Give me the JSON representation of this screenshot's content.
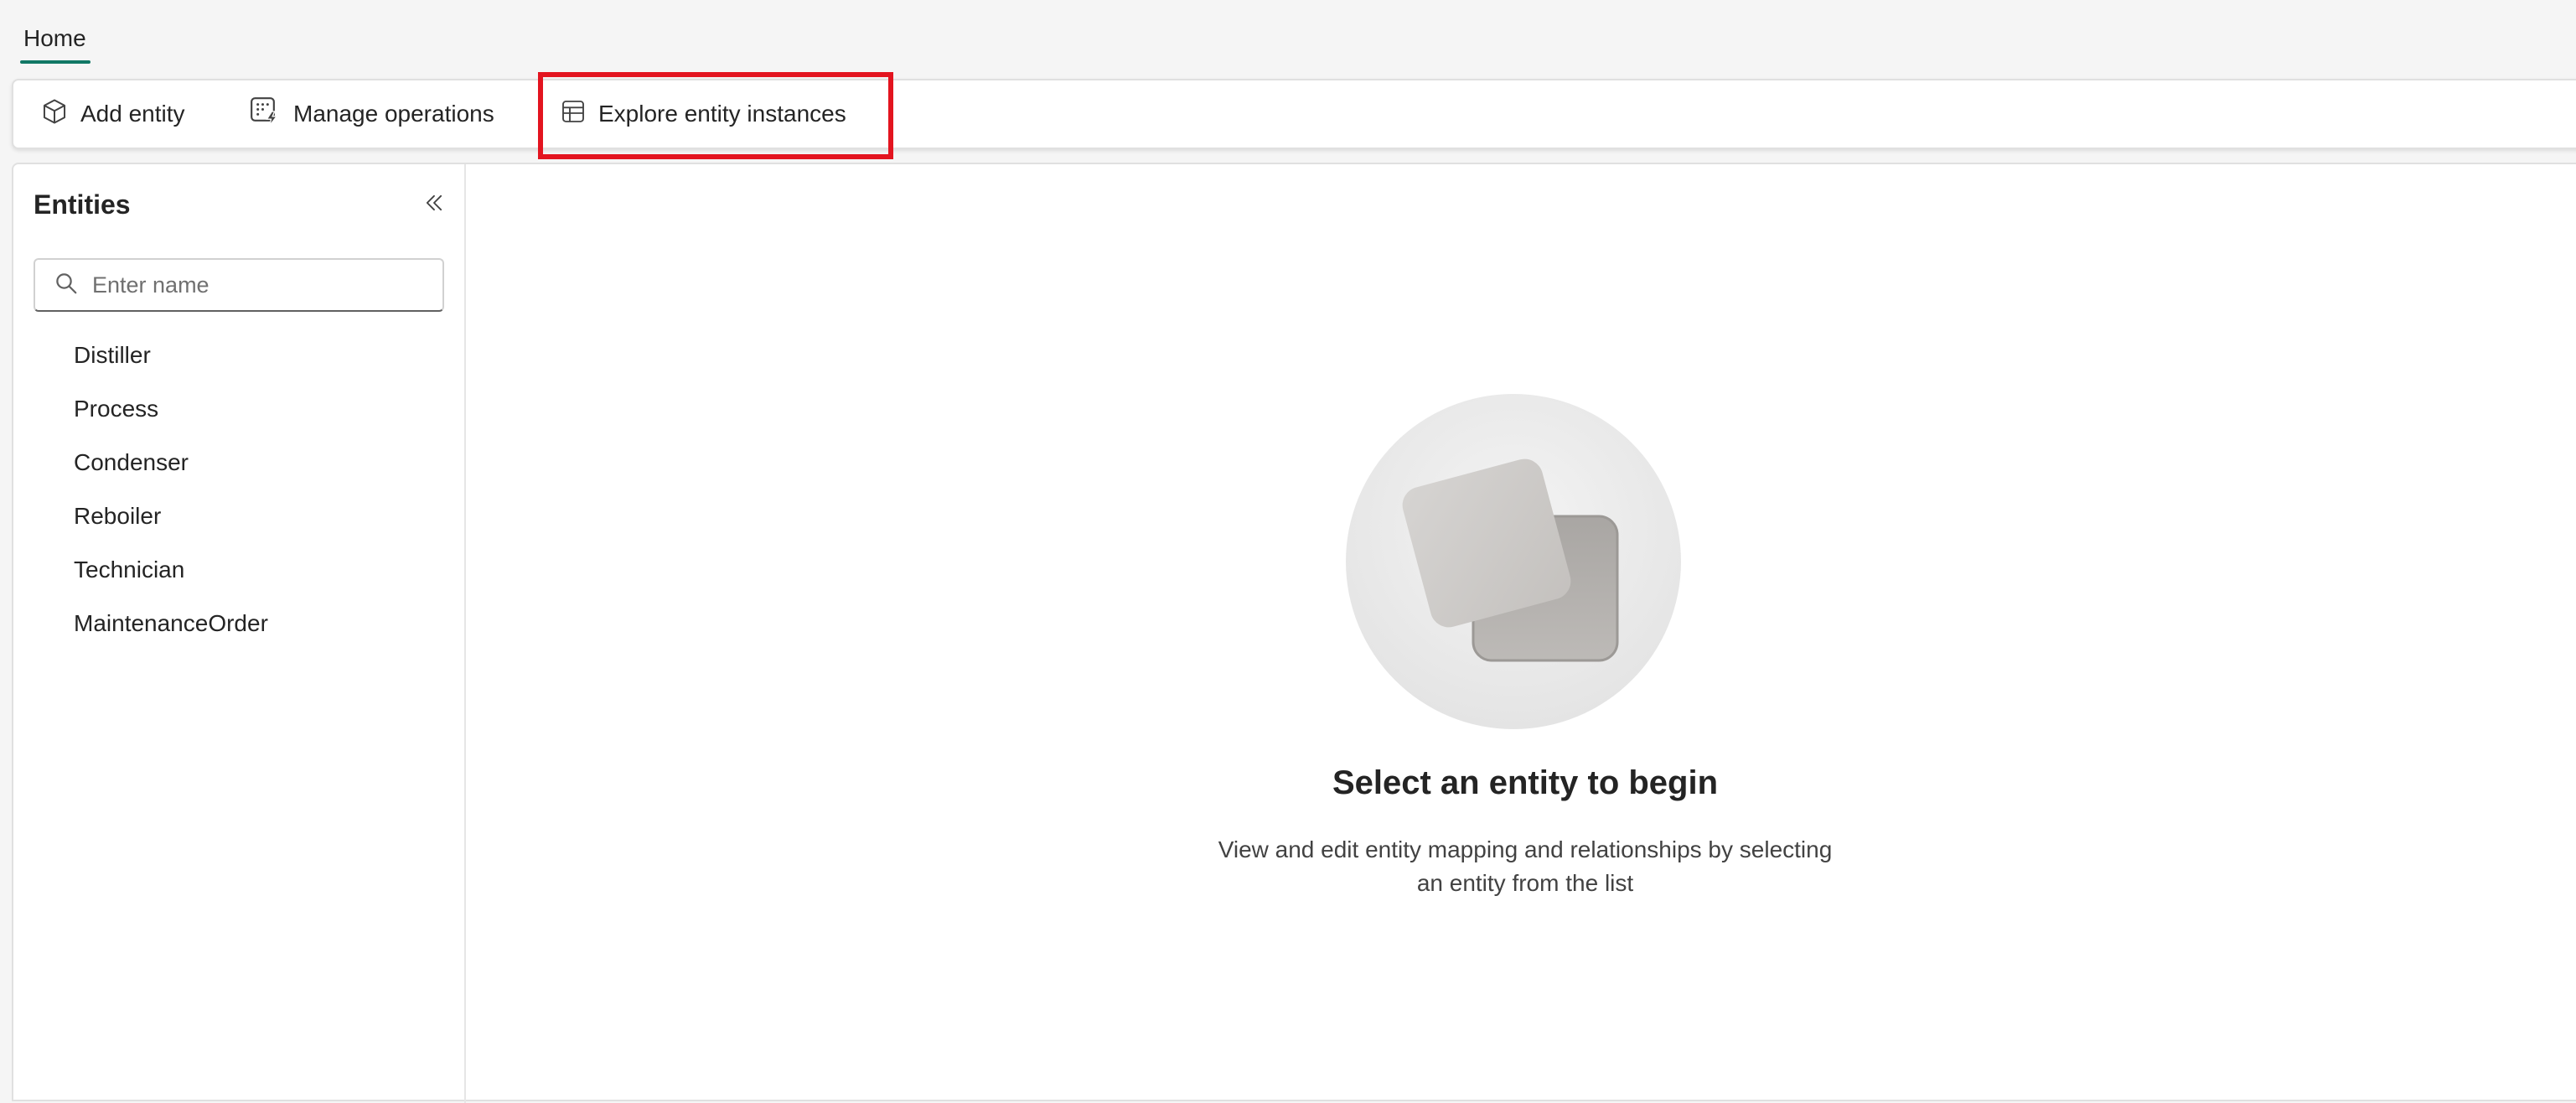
{
  "tabs": [
    {
      "label": "Home",
      "selected": true
    }
  ],
  "toolbar": {
    "add_entity": {
      "label": "Add entity",
      "icon": "cube-icon"
    },
    "manage_operations": {
      "label": "Manage operations",
      "icon": "grid-flash-icon"
    },
    "explore_entity_instances": {
      "label": "Explore entity instances",
      "icon": "table-icon",
      "highlighted": true
    }
  },
  "sidebar": {
    "title": "Entities",
    "collapse_icon": "double-chevron-left-icon",
    "search": {
      "placeholder": "Enter name",
      "value": ""
    },
    "items": [
      {
        "label": "Distiller"
      },
      {
        "label": "Process"
      },
      {
        "label": "Condenser"
      },
      {
        "label": "Reboiler"
      },
      {
        "label": "Technician"
      },
      {
        "label": "MaintenanceOrder"
      }
    ]
  },
  "empty_state": {
    "icon": "stacked-squares-illustration",
    "title": "Select an entity to begin",
    "description_line1": "View and edit entity mapping and relationships by selecting",
    "description_line2": "an entity from the list"
  },
  "colors": {
    "accent": "#117865",
    "highlight": "#e3141f"
  }
}
